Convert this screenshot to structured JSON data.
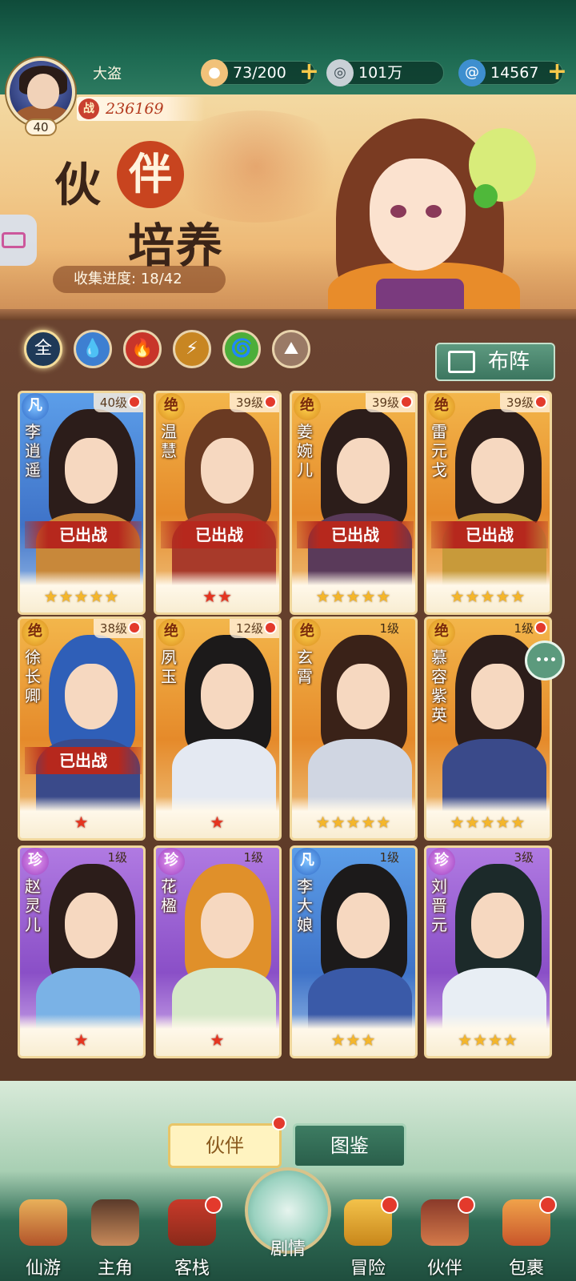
{
  "player": {
    "name": "大盗",
    "level": "40",
    "power_icon": "战",
    "power": "236169"
  },
  "resources": [
    {
      "icon": "bun-icon",
      "value": "73/200"
    },
    {
      "icon": "coin-icon",
      "value": "101万"
    },
    {
      "icon": "swirl-icon",
      "value": "14567"
    }
  ],
  "banner": {
    "title_1": "伙",
    "title_2": "伴",
    "title_3": "培养",
    "collect_label": "收集进度:",
    "collect_value": "18/42"
  },
  "filters": [
    {
      "key": "all",
      "label": "全"
    },
    {
      "key": "water",
      "label": "💧"
    },
    {
      "key": "fire",
      "label": "🔥"
    },
    {
      "key": "thunder",
      "label": "⚡"
    },
    {
      "key": "wind",
      "label": "🌀"
    },
    {
      "key": "earth",
      "label": "⛰"
    }
  ],
  "arrange_label": "布阵",
  "deployed_label": "已出战",
  "cards": [
    {
      "name": "李逍遥",
      "grade": "凡",
      "level": "40级",
      "stars": 5,
      "deployed": true
    },
    {
      "name": "温慧",
      "grade": "绝",
      "level": "39级",
      "stars": 2,
      "deployed": true
    },
    {
      "name": "姜婉儿",
      "grade": "绝",
      "level": "39级",
      "stars": 5,
      "deployed": true
    },
    {
      "name": "雷元戈",
      "grade": "绝",
      "level": "39级",
      "stars": 5,
      "deployed": true
    },
    {
      "name": "徐长卿",
      "grade": "绝",
      "level": "38级",
      "stars": 1,
      "deployed": true
    },
    {
      "name": "夙玉",
      "grade": "绝",
      "level": "12级",
      "stars": 1,
      "deployed": false
    },
    {
      "name": "玄霄",
      "grade": "绝",
      "level": "1级",
      "stars": 5,
      "deployed": false
    },
    {
      "name": "慕容紫英",
      "grade": "绝",
      "level": "1级",
      "stars": 5,
      "deployed": false
    },
    {
      "name": "赵灵儿",
      "grade": "珍",
      "level": "1级",
      "stars": 1,
      "deployed": false
    },
    {
      "name": "花楹",
      "grade": "珍",
      "level": "1级",
      "stars": 1,
      "deployed": false
    },
    {
      "name": "李大娘",
      "grade": "凡",
      "level": "1级",
      "stars": 3,
      "deployed": false
    },
    {
      "name": "刘晋元",
      "grade": "珍",
      "level": "3级",
      "stars": 4,
      "deployed": false
    }
  ],
  "tabs": {
    "companion": "伙伴",
    "atlas": "图鉴"
  },
  "nav": [
    {
      "label": "仙游"
    },
    {
      "label": "主角"
    },
    {
      "label": "客栈"
    },
    {
      "label": "剧情"
    },
    {
      "label": "冒险"
    },
    {
      "label": "伙伴"
    },
    {
      "label": "包裹"
    }
  ],
  "colors": {
    "accent_red": "#e33a2c",
    "panel_brown": "#5a3826",
    "header_green": "#1d6a52",
    "star_gold": "#f4b62b"
  }
}
